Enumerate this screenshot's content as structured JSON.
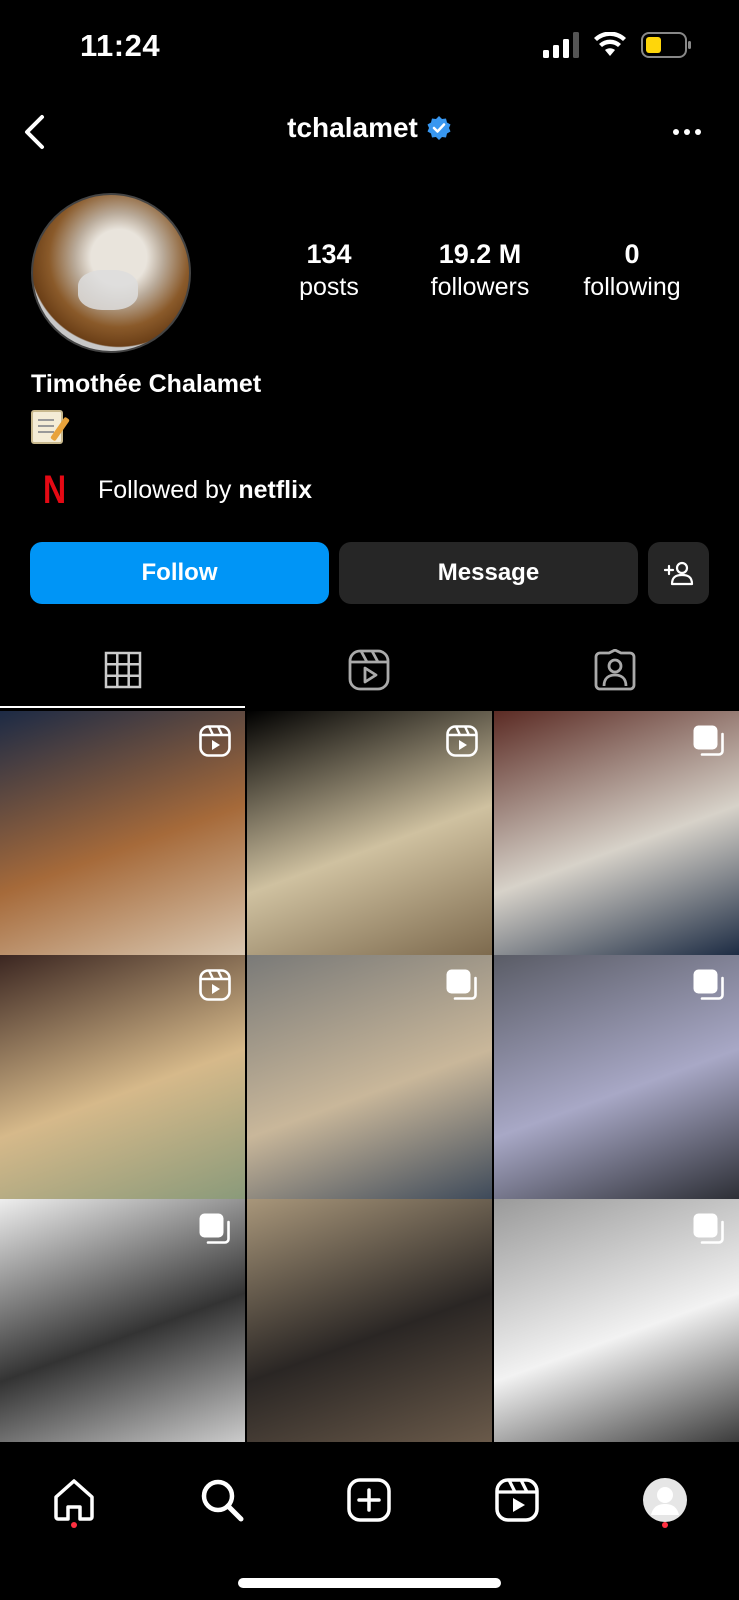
{
  "status_bar": {
    "time": "11:24"
  },
  "header": {
    "username": "tchalamet"
  },
  "profile": {
    "posts_count": "134",
    "posts_label": "posts",
    "followers_count": "19.2 M",
    "followers_label": "followers",
    "following_count": "0",
    "following_label": "following",
    "full_name": "Timothée Chalamet",
    "bio_emoji_icon": "memo-icon",
    "followed_by_prefix": "Followed by ",
    "followed_by_name": "netflix",
    "followed_by_logo_letter": "N"
  },
  "actions": {
    "follow_label": "Follow",
    "message_label": "Message"
  },
  "tabs": [
    {
      "name": "grid-tab-icon"
    },
    {
      "name": "reels-tab-icon"
    },
    {
      "name": "tagged-tab-icon"
    }
  ],
  "grid": [
    {
      "badge": "reel-icon",
      "colors": [
        "#1c2a45",
        "#a66a3a",
        "#d9c7b0"
      ]
    },
    {
      "badge": "reel-icon",
      "colors": [
        "#000000",
        "#cfc1a0",
        "#7d6a4e"
      ]
    },
    {
      "badge": "carousel-icon",
      "colors": [
        "#5b2b24",
        "#d7d2c9",
        "#1d2c44"
      ]
    },
    {
      "badge": "reel-icon",
      "colors": [
        "#3b2621",
        "#d6b98a",
        "#8a9a7a"
      ]
    },
    {
      "badge": "carousel-icon",
      "colors": [
        "#7a7a78",
        "#c9b79a",
        "#3e4a5a"
      ]
    },
    {
      "badge": "carousel-icon",
      "colors": [
        "#5a5c66",
        "#a8a8c6",
        "#2d2f36"
      ]
    },
    {
      "badge": "carousel-icon",
      "colors": [
        "#eeeeee",
        "#333333",
        "#cccccc"
      ]
    },
    {
      "badge": "",
      "colors": [
        "#a8967a",
        "#2a2624",
        "#6a5a4a"
      ]
    },
    {
      "badge": "carousel-icon",
      "colors": [
        "#9a9a9a",
        "#f2f2f2",
        "#3a3a3a"
      ]
    }
  ],
  "bottom_nav": [
    {
      "name": "home-icon"
    },
    {
      "name": "search-icon"
    },
    {
      "name": "create-icon"
    },
    {
      "name": "reels-icon"
    },
    {
      "name": "profile-avatar-icon"
    }
  ]
}
